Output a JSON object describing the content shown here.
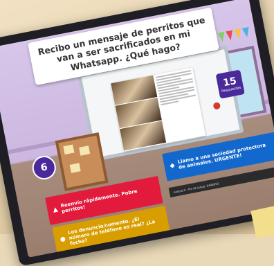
{
  "question": {
    "text": "Recibo un mensaje de perritos que van a ser sacrificados en mi Whatsapp. ¿Qué hago?"
  },
  "timer": {
    "seconds": "6"
  },
  "answers_count": {
    "value": "15",
    "label": "Respuestas"
  },
  "answers": [
    {
      "color": "#e21b3c",
      "shape": "triangle",
      "symbol": "▲",
      "text": "Reenvío rápidamente. Pobre perritos!"
    },
    {
      "color": "#1368ce",
      "shape": "diamond",
      "symbol": "◆",
      "text": "Llamo a una sociedad protectora de animales. URGENTE!"
    },
    {
      "color": "#d89e00",
      "shape": "circle",
      "symbol": "●",
      "text": "Los denuncio/comento. ¿El número de teléfono es real? ¿La fecha?"
    }
  ],
  "footer": {
    "text": "kahoot.it · Pin de juego: 9448993"
  }
}
